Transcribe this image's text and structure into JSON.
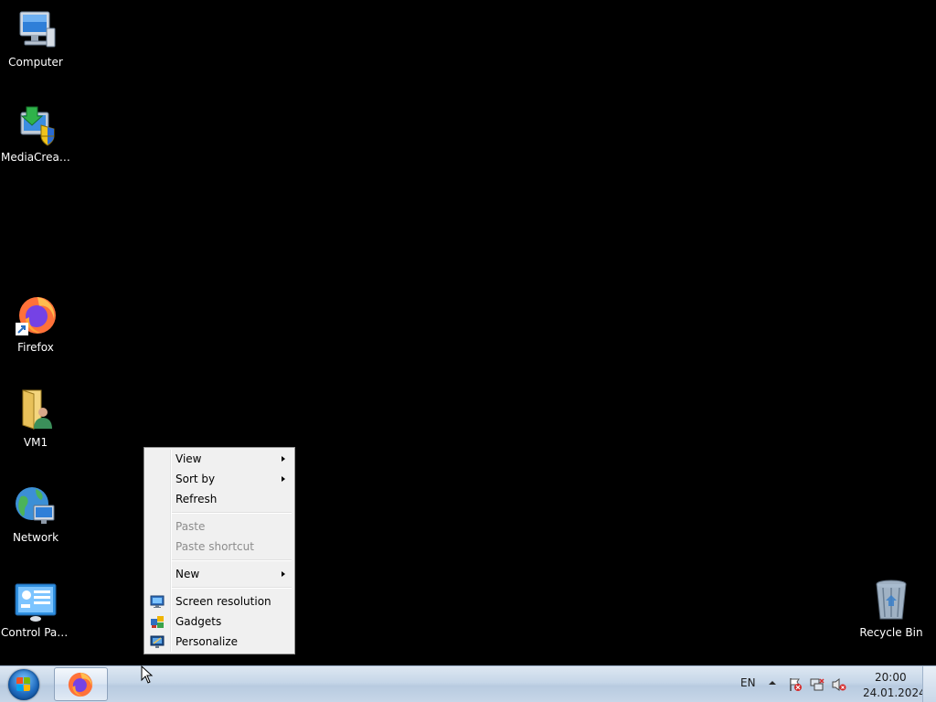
{
  "desktop": {
    "icons": [
      {
        "label": "Computer",
        "icon": "computer-icon"
      },
      {
        "label": "MediaCreat...",
        "icon": "media-creation-tool-icon"
      },
      {
        "label": "Firefox",
        "icon": "firefox-icon"
      },
      {
        "label": "VM1",
        "icon": "user-folder-icon"
      },
      {
        "label": "Network",
        "icon": "network-icon"
      },
      {
        "label": "Control Panel",
        "icon": "control-panel-icon"
      },
      {
        "label": "Recycle Bin",
        "icon": "recycle-bin-icon"
      }
    ]
  },
  "context_menu": {
    "view": "View",
    "sort_by": "Sort by",
    "refresh": "Refresh",
    "paste": "Paste",
    "paste_shortcut": "Paste shortcut",
    "new": "New",
    "screen_resolution": "Screen resolution",
    "gadgets": "Gadgets",
    "personalize": "Personalize"
  },
  "taskbar": {
    "pinned": [
      {
        "name": "Firefox",
        "icon": "firefox-icon"
      }
    ],
    "tray": {
      "language": "EN",
      "time": "20:00",
      "date": "24.01.2024",
      "icons": [
        "show-hidden-icons-arrow",
        "action-center-flag-icon",
        "network-disconnected-icon",
        "volume-muted-icon"
      ]
    }
  },
  "colors": {
    "desktop_bg": "#000000",
    "menu_bg": "#f0f0f0",
    "taskbar_bg": "#c6d6e8"
  }
}
